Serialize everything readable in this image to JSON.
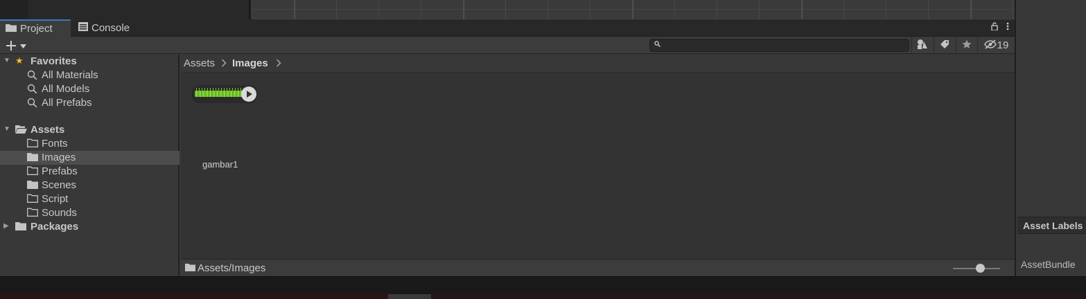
{
  "tabs": [
    {
      "label": "Project",
      "icon": "folder-icon"
    },
    {
      "label": "Console",
      "icon": "console-icon"
    }
  ],
  "toolbar": {
    "search_value": "",
    "hidden_count": "19"
  },
  "tree": {
    "favorites": {
      "label": "Favorites",
      "items": [
        "All Materials",
        "All Models",
        "All Prefabs"
      ]
    },
    "assets": {
      "label": "Assets",
      "items": [
        {
          "label": "Fonts",
          "icon": "empty-folder-icon"
        },
        {
          "label": "Images",
          "icon": "folder-icon",
          "selected": true
        },
        {
          "label": "Prefabs",
          "icon": "empty-folder-icon"
        },
        {
          "label": "Scenes",
          "icon": "folder-icon"
        },
        {
          "label": "Script",
          "icon": "empty-folder-icon"
        },
        {
          "label": "Sounds",
          "icon": "empty-folder-icon"
        }
      ]
    },
    "packages": {
      "label": "Packages"
    }
  },
  "breadcrumb": [
    "Assets",
    "Images"
  ],
  "assets": [
    {
      "name": "gambar1"
    }
  ],
  "status": {
    "path": "Assets/Images"
  },
  "inspector": {
    "section_label": "Asset Labels",
    "bundle_label": "AssetBundle"
  },
  "colors": {
    "accent": "#3a79bb",
    "favorite_star": "#f2bd1d",
    "grass": "#7ac534"
  }
}
